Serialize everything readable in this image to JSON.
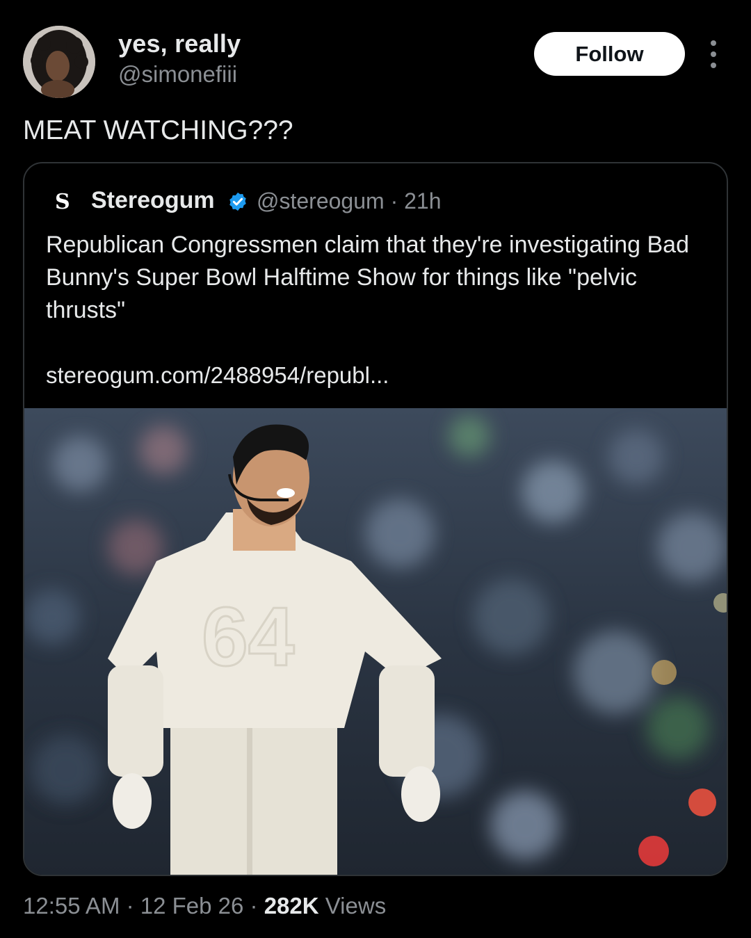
{
  "author": {
    "display_name": "yes, really",
    "handle": "@simonefiii"
  },
  "follow_label": "Follow",
  "tweet_text": "MEAT WATCHING???",
  "quoted": {
    "logo_letter": "S",
    "name": "Stereogum",
    "meta": "@stereogum · 21h",
    "text": "Republican Congressmen claim that they're investigating Bad Bunny's Super Bowl Halftime Show for things like \"pelvic thrusts\"",
    "link": "stereogum.com/2488954/republ...",
    "jersey_number": "64"
  },
  "footer": {
    "time_date": "12:55 AM · 12 Feb 26 · ",
    "views_count": "282K",
    "views_label": " Views"
  },
  "colors": {
    "background": "#000000",
    "text_primary": "#e7e9ea",
    "text_secondary": "#8b8f94",
    "verified_blue": "#1d9bf0",
    "border": "#2f3336"
  }
}
